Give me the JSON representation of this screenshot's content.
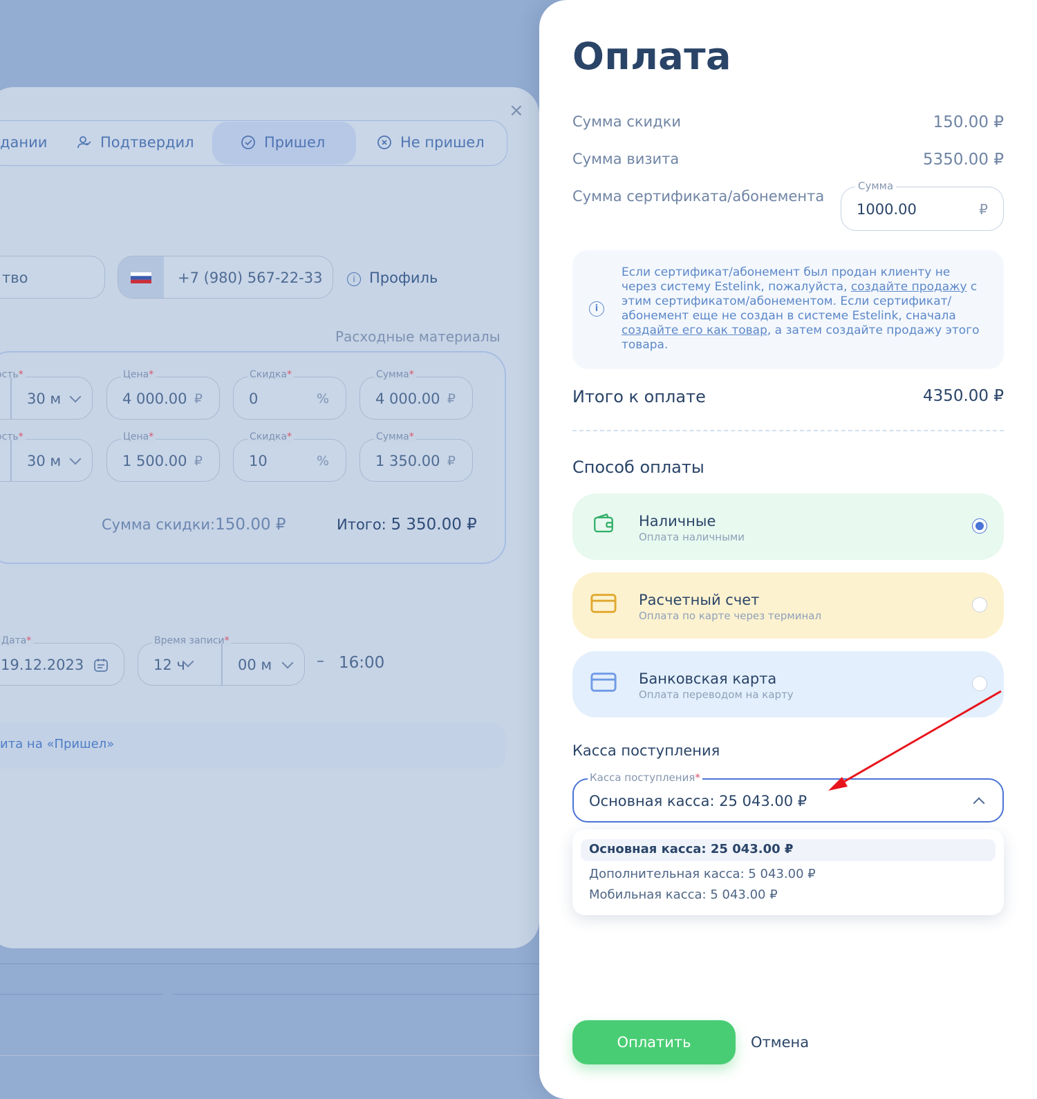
{
  "background": {
    "status_tabs": [
      "дании",
      "Подтвердил",
      "Пришел",
      "Не пришел"
    ],
    "active_status": "Пришел",
    "name_field_value": "тво",
    "phone": "+7 (980) 567-22-33",
    "profile_link": "Профиль",
    "consumables_label": "Расходные материалы",
    "rows": [
      {
        "duration_label": "ость",
        "duration": "30 м",
        "price_label": "Цена",
        "price": "4 000.00",
        "discount_label": "Скидка",
        "discount": "0",
        "sum_label": "Сумма",
        "sum": "4 000.00"
      },
      {
        "duration_label": "ость",
        "duration": "30 м",
        "price_label": "Цена",
        "price": "1 500.00",
        "discount_label": "Скидка",
        "discount": "10",
        "sum_label": "Сумма",
        "sum": "1 350.00"
      }
    ],
    "currency": "₽",
    "percent": "%",
    "discount_total_label": "Сумма скидки:",
    "discount_total": "150.00 ₽",
    "total_label": "Итого:",
    "total": "5 350.00 ₽",
    "date_label": "Дата",
    "date": "19.12.2023",
    "time_label": "Время записи",
    "hours": "12 ч",
    "minutes": "00 м",
    "dash": "–",
    "end_time": "16:00",
    "status_hint": "ита на «Пришел»"
  },
  "panel": {
    "title": "Оплата",
    "discount_label": "Сумма скидки",
    "discount_value": "150.00 ₽",
    "visit_label": "Сумма визита",
    "visit_value": "5350.00 ₽",
    "cert_label": "Сумма сертификата/абонемента",
    "cert_field_label": "Сумма",
    "cert_field_value": "1000.00",
    "cert_currency": "₽",
    "info_text_1": "Если сертификат/абонемент был продан клиенту не через систему Estelink, пожалуйста, ",
    "info_link_1": "создайте продажу",
    "info_text_2": " с этим сертификатом/абонементом. Если сертификат/абонемент еще не создан в системе Estelink, сначала ",
    "info_link_2": "создайте его как товар",
    "info_text_3": ", а затем создайте продажу этого товара.",
    "total_label": "Итого к оплате",
    "total_value": "4350.00 ₽",
    "payment_title": "Способ оплаты",
    "payment_methods": [
      {
        "name": "Наличные",
        "sub": "Оплата наличными",
        "selected": true,
        "bg": "#e8f9ef",
        "icon": "wallet-icon",
        "color": "#2fae67"
      },
      {
        "name": "Расчетный счет",
        "sub": "Оплата по карте через терминал",
        "selected": false,
        "bg": "#fdf2cf",
        "icon": "card-icon",
        "color": "#e0a82e"
      },
      {
        "name": "Банковская карта",
        "sub": "Оплата переводом на карту",
        "selected": false,
        "bg": "#e3effc",
        "icon": "bank-card-icon",
        "color": "#6f9ae6"
      }
    ],
    "cashbox_title": "Касса поступления",
    "cashbox_field_label": "Касса поступления",
    "cashbox_value": "Основная касса: 25 043.00 ₽",
    "cashbox_options": [
      "Основная касса: 25 043.00 ₽",
      "Дополнительная касса: 5 043.00 ₽",
      "Мобильная касса: 5 043.00 ₽"
    ],
    "pay_button": "Оплатить",
    "cancel_button": "Отмена"
  },
  "colors": {
    "accent": "#4a74d6",
    "pay_button": "#49cd74",
    "annotation_arrow": "#e8141c"
  }
}
